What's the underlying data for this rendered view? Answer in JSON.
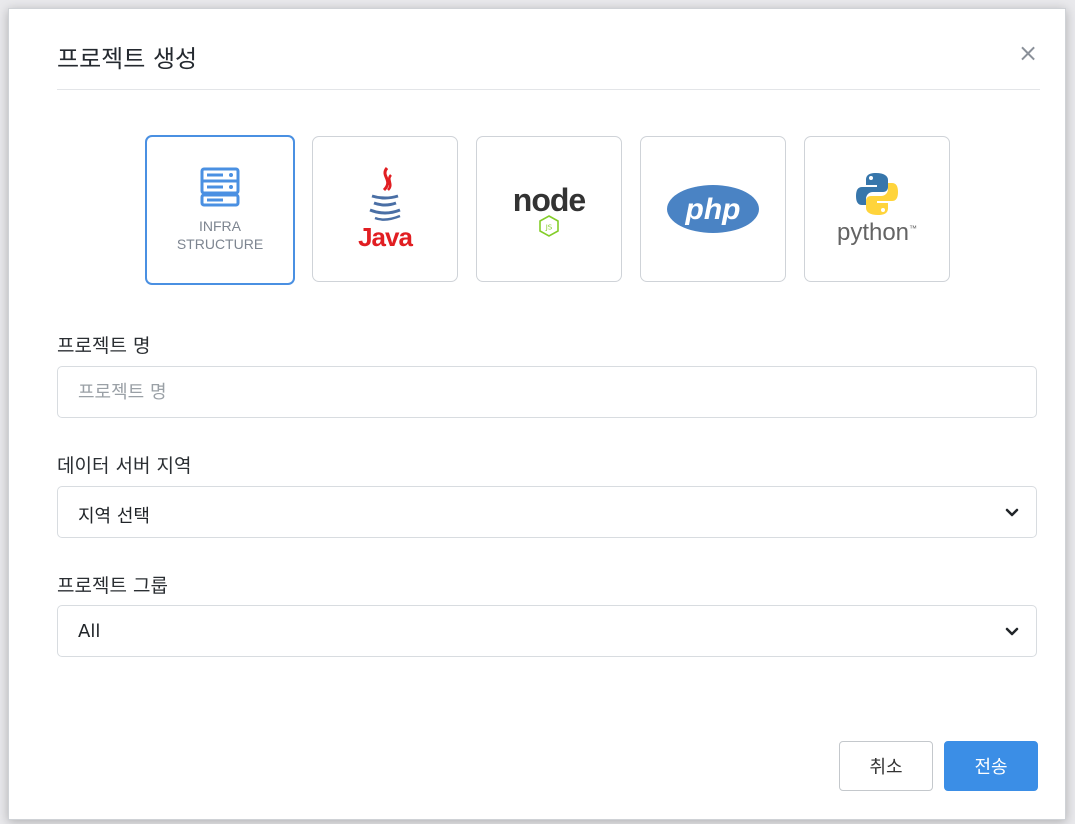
{
  "dialog": {
    "title": "프로젝트 생성",
    "close_icon": "×"
  },
  "project_types": [
    {
      "id": "infra",
      "label_line1": "INFRA",
      "label_line2": "STRUCTURE",
      "icon": "server-icon",
      "selected": true,
      "color": "#4a90e2"
    },
    {
      "id": "java",
      "label": "Java",
      "icon": "java-logo",
      "selected": false,
      "color": "#e11e22"
    },
    {
      "id": "node",
      "label": "node",
      "sub": "JS",
      "icon": "nodejs-logo",
      "selected": false,
      "color": "#83cd29"
    },
    {
      "id": "php",
      "label": "php",
      "icon": "php-logo",
      "selected": false,
      "color": "#4a83c4"
    },
    {
      "id": "python",
      "label": "python",
      "tm": "™",
      "icon": "python-logo",
      "selected": false,
      "colors": [
        "#3776ab",
        "#ffd43b"
      ]
    }
  ],
  "fields": {
    "project_name": {
      "label": "프로젝트 명",
      "placeholder": "프로젝트 명",
      "value": ""
    },
    "data_server_region": {
      "label": "데이터 서버 지역",
      "selected": "지역 선택"
    },
    "project_group": {
      "label": "프로젝트 그룹",
      "selected": "All"
    }
  },
  "buttons": {
    "cancel": "취소",
    "submit": "전송"
  },
  "colors": {
    "accent": "#3b8ee6",
    "selected_border": "#4a90e2"
  }
}
